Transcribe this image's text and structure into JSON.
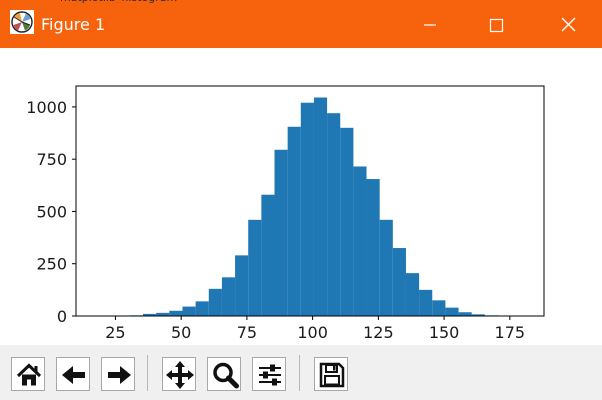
{
  "window": {
    "title": "Figure 1",
    "background_title": "matplotlib_histogram",
    "titlebar_color": "#f7630c",
    "controls": [
      "minimize-icon",
      "maximize-icon",
      "close-icon"
    ]
  },
  "toolbar": {
    "buttons": [
      "home-icon",
      "back-arrow-icon",
      "forward-arrow-icon",
      "pan-icon",
      "zoom-icon",
      "configure-subplots-icon",
      "save-icon"
    ]
  },
  "chart_data": {
    "type": "bar",
    "title": "",
    "xlabel": "",
    "ylabel": "",
    "bar_color": "#1f77b4",
    "bin_edges": [
      30.5,
      35.5,
      40.5,
      45.5,
      50.5,
      55.5,
      60.5,
      65.5,
      70.5,
      75.5,
      80.5,
      85.5,
      90.5,
      95.5,
      100.5,
      105.5,
      110.5,
      115.5,
      120.5,
      125.5,
      130.5,
      135.5,
      140.5,
      145.5,
      150.5,
      155.5,
      160.5,
      165.5,
      170.5,
      175.5,
      180.5
    ],
    "values": [
      3,
      10,
      15,
      25,
      45,
      70,
      130,
      185,
      290,
      460,
      580,
      795,
      905,
      1020,
      1045,
      970,
      900,
      715,
      655,
      460,
      325,
      205,
      125,
      75,
      40,
      18,
      8,
      3,
      1,
      1
    ],
    "xlim": [
      10,
      188
    ],
    "ylim": [
      0,
      1100
    ],
    "xticks": [
      25,
      50,
      75,
      100,
      125,
      150,
      175
    ],
    "yticks": [
      0,
      250,
      500,
      750,
      1000
    ],
    "grid": false,
    "legend": "none"
  }
}
